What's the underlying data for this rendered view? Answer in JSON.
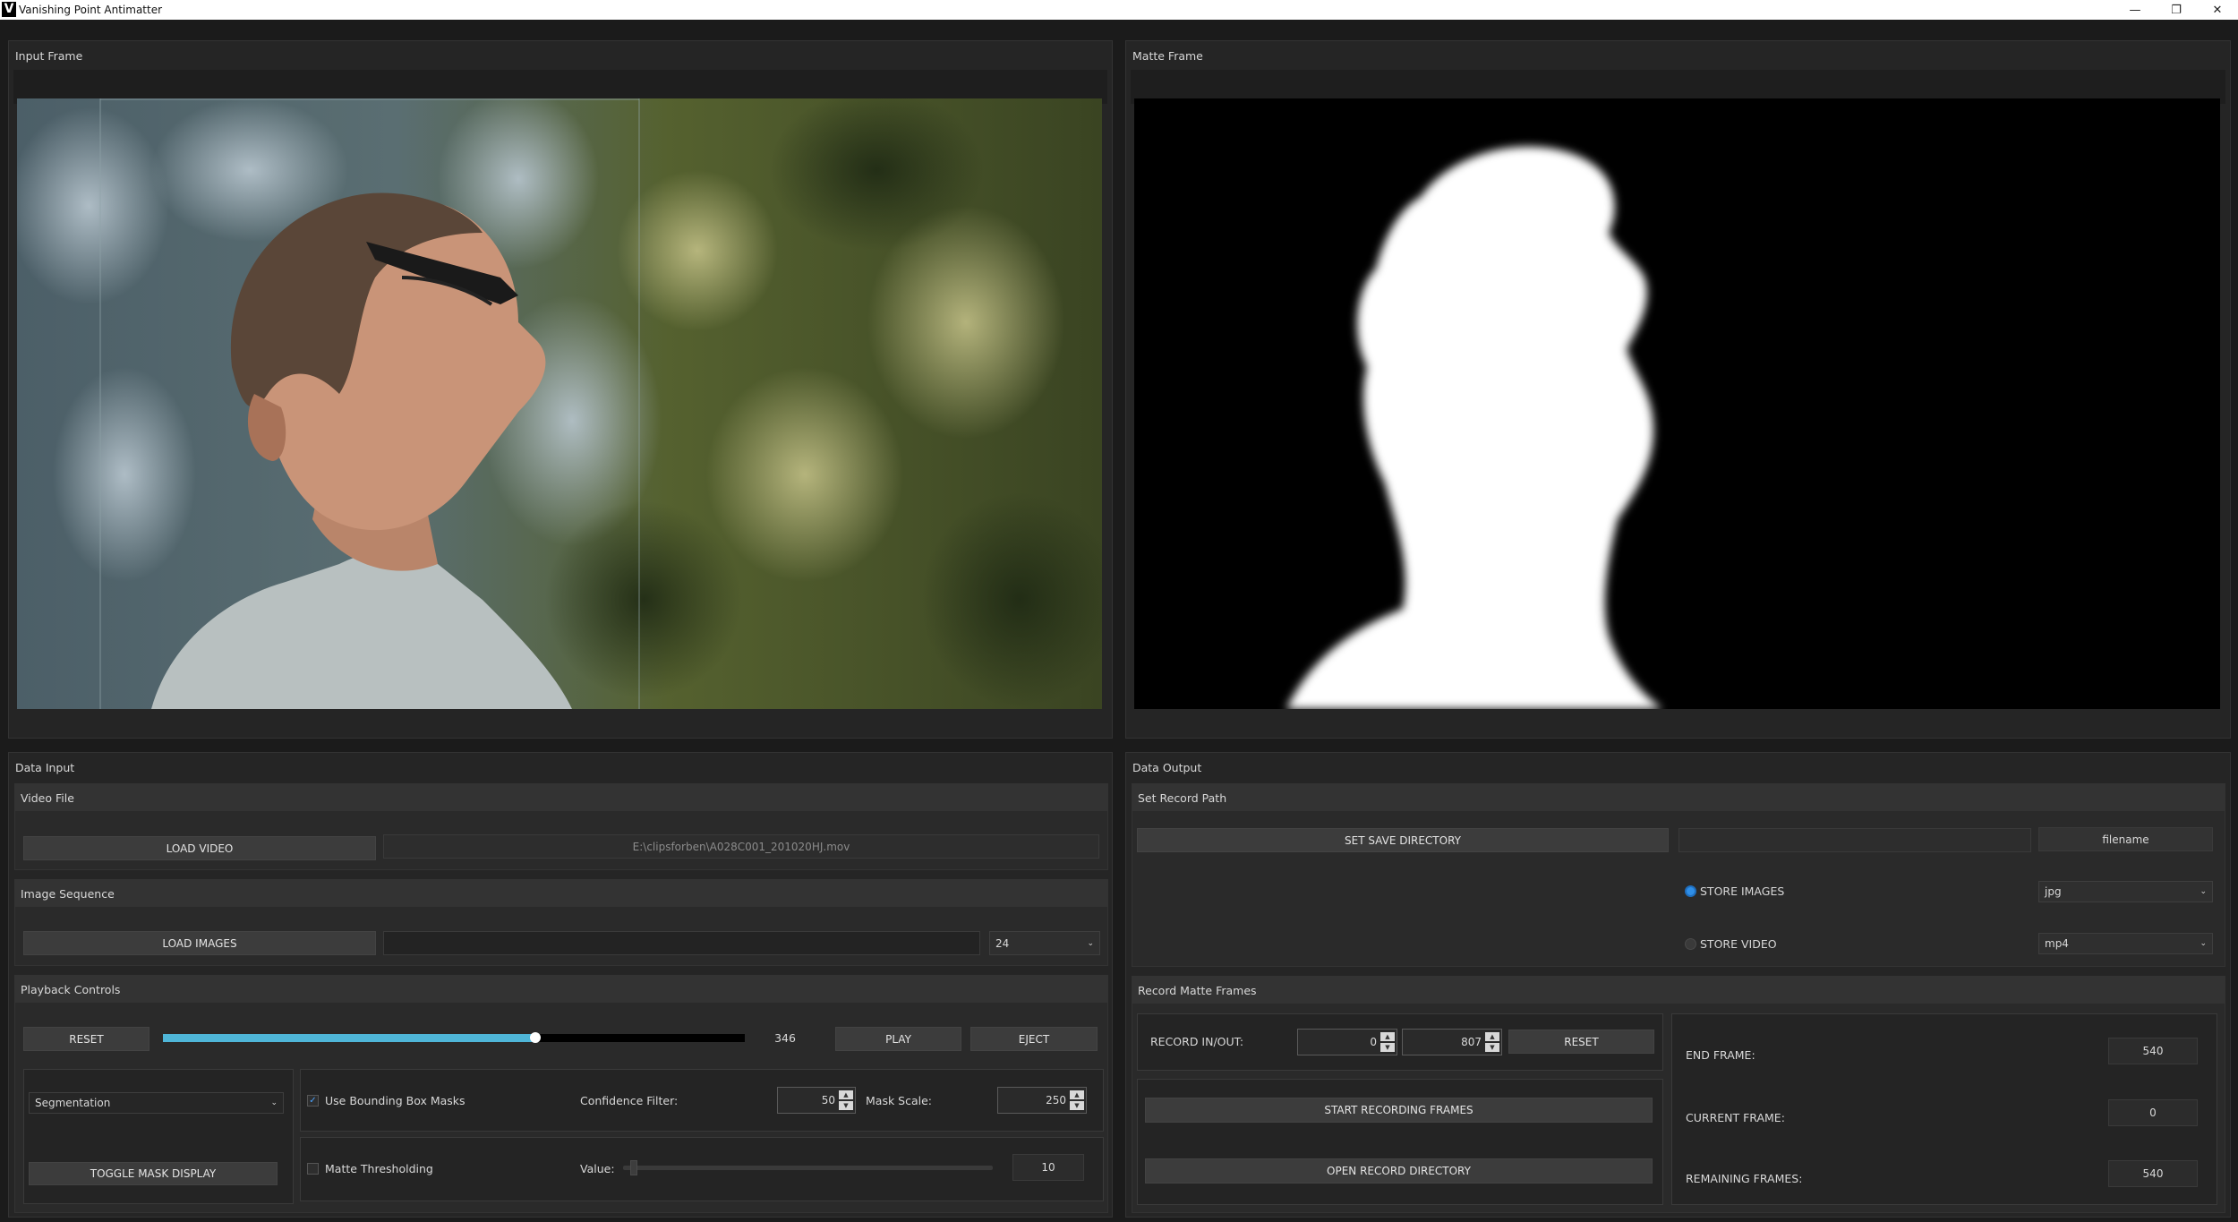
{
  "app": {
    "title": "Vanishing Point Antimatter",
    "logo_letter": "V"
  },
  "window_controls": {
    "minimize": "—",
    "restore": "❐",
    "close": "✕"
  },
  "input_frame": {
    "title": "Input Frame"
  },
  "matte_frame": {
    "title": "Matte Frame"
  },
  "data_input": {
    "title": "Data Input",
    "video_file": {
      "heading": "Video File",
      "load_button": "LOAD VIDEO",
      "path": "E:\\clipsforben\\A028C001_201020HJ.mov"
    },
    "image_sequence": {
      "heading": "Image Sequence",
      "load_button": "LOAD IMAGES",
      "path": "",
      "fps_value": "24"
    },
    "playback": {
      "heading": "Playback Controls",
      "reset_button": "RESET",
      "progress": 0.64,
      "frame_value": "346",
      "play_button": "PLAY",
      "eject_button": "EJECT"
    },
    "mask": {
      "mode_value": "Segmentation",
      "toggle_button": "TOGGLE MASK DISPLAY",
      "bounding_box_label": "Use Bounding Box Masks",
      "bounding_box_checked": true,
      "confidence_label": "Confidence Filter:",
      "confidence_value": "50",
      "mask_scale_label": "Mask Scale:",
      "mask_scale_value": "250",
      "thresholding_label": "Matte Thresholding",
      "thresholding_checked": false,
      "value_label": "Value:",
      "threshold_value": "10",
      "threshold_slider": 0.02
    }
  },
  "data_output": {
    "title": "Data Output",
    "record_path": {
      "heading": "Set Record Path",
      "save_dir_button": "SET SAVE DIRECTORY",
      "save_dir_value": "",
      "filename_placeholder": "filename",
      "store_images_label": "STORE IMAGES",
      "store_images_selected": true,
      "image_format": "jpg",
      "store_video_label": "STORE VIDEO",
      "store_video_selected": false,
      "video_format": "mp4"
    },
    "record_matte": {
      "heading": "Record Matte Frames",
      "in_out_label": "RECORD IN/OUT:",
      "in_value": "0",
      "out_value": "807",
      "reset_button": "RESET",
      "start_button": "START RECORDING FRAMES",
      "open_dir_button": "OPEN RECORD DIRECTORY",
      "end_frame_label": "END FRAME:",
      "end_frame_value": "540",
      "current_frame_label": "CURRENT FRAME:",
      "current_frame_value": "0",
      "remaining_frames_label": "REMAINING FRAMES:",
      "remaining_frames_value": "540"
    }
  },
  "colors": {
    "accent": "#4fb6d8",
    "radio_selected": "#2f8fe8"
  }
}
